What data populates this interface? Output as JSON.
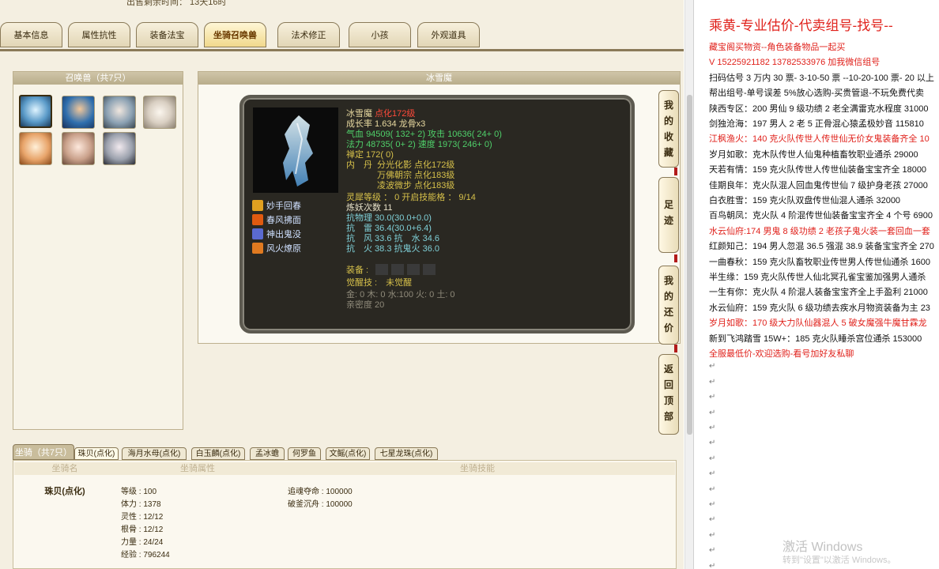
{
  "top_info": "出售剩余时间： 13天16时",
  "tabs": [
    "基本信息",
    "属性抗性",
    "装备法宝",
    "坐骑召唤兽",
    "法术修正",
    "小孩",
    "外观道具"
  ],
  "summon_panel_title": "召唤兽（共7只）",
  "detail_panel_title": "冰雪魔",
  "pet": {
    "name": "冰雪魔",
    "grade": "点化172级",
    "growth": "成长率 1.634 龙骨x3",
    "hp_label": "气血",
    "hp": "94509( 132+ 2)",
    "atk_label": "攻击",
    "atk": "10636( 24+ 0)",
    "mp_label": "法力",
    "mp": "48735( 0+ 2)",
    "spd_label": "速度",
    "spd": "1973( 246+ 0)",
    "zen": "禅定 172( 0)",
    "neidan_label": "内　丹",
    "neidan": [
      "分光化影 点化172级",
      "万佛朝宗 点化183级",
      "凌波微步 点化183级"
    ],
    "lingxi": "灵犀等级 ： 0 开启技能格 ： 9/14",
    "lianyao": "炼妖次数 11",
    "resist": [
      "抗物理 30.0(30.0+0.0)",
      "抗　雷 36.4(30.0+6.4)",
      "抗　风 33.6 抗　水 34.6",
      "抗　火 38.3 抗鬼火 36.0"
    ],
    "equip_label": "装备 :",
    "awaken": "觉醒技 :　未觉醒",
    "elements": "金: 0 木: 0 水:100 火: 0 土: 0",
    "intimacy": "亲密度 20",
    "skills": [
      "妙手回春",
      "春风拂面",
      "神出鬼没",
      "风火燎原"
    ]
  },
  "side_buttons": [
    [
      "我",
      "的",
      "收",
      "藏"
    ],
    [
      "足",
      "迹"
    ],
    [
      "我",
      "的",
      "还",
      "价"
    ],
    [
      "返",
      "回",
      "顶",
      "部"
    ]
  ],
  "mount_tabs": [
    "坐骑（共7只）",
    "珠贝(点化)",
    "海月水母(点化)",
    "白玉麟(点化)",
    "孟冰蟾",
    "何罗鱼",
    "文鳐(点化)",
    "七星龙珠(点化)"
  ],
  "mount_headers": [
    "坐骑名",
    "坐骑属性",
    "坐骑技能"
  ],
  "mount": {
    "name": "珠贝(点化)",
    "stats": [
      "等级 : 100",
      "体力 : 1378",
      "灵性 : 12/12",
      "根骨 : 12/12",
      "力量 : 24/24",
      "经验 : 796244"
    ],
    "skills": [
      "追魂夺命 : 100000",
      "破釜沉舟 : 100000"
    ]
  },
  "right": {
    "title": "乘黄-专业估价-代卖组号-找号--",
    "lines": [
      {
        "t": "藏宝阁买物资--角色装备物品一起买",
        "c": "red"
      },
      {
        "t": "V 15225921182  13782533976  加我微信组号",
        "c": "red"
      },
      {
        "t": "扫码估号 3 万内 30 票- 3-10-50 票  --10-20-100 票- 20 以上",
        "c": "blk"
      },
      {
        "t": "帮出组号-单号误差 5%放心选购-买贵管退-不玩免费代卖",
        "c": "blk"
      },
      {
        "t": "陕西专区：200 男仙 9 级功绩 2 老全满雷克水程度 31000",
        "c": "blk"
      },
      {
        "t": "剑独沧海：197 男人 2 老 5 正骨混心猿孟极妙音 115810",
        "c": "blk"
      },
      {
        "t": "江枫渔火：140 克火队传世人传世仙无价女鬼装备齐全 10",
        "c": "red"
      },
      {
        "t": "岁月如歌：克木队传世人仙鬼种植畜牧职业通杀 29000",
        "c": "blk"
      },
      {
        "t": "天若有情：159 克火队传世人传世仙装备宝宝齐全 18000",
        "c": "blk"
      },
      {
        "t": "佳期良年：克火队混人回血鬼传世仙 7 级护身老孩 27000",
        "c": "blk"
      },
      {
        "t": "白衣胜雪：159 克火队双盘传世仙混人通杀 32000",
        "c": "blk"
      },
      {
        "t": "百鸟朝凤：克火队 4 阶混传世仙装备宝宝齐全 4 个号 6900",
        "c": "blk"
      },
      {
        "t": "水云仙府:174 男鬼 8 级功绩 2 老孩子鬼火装一套回血一套",
        "c": "red"
      },
      {
        "t": "红颜知己：194 男人忽混 36.5 强混 38.9 装备宝宝齐全 270",
        "c": "blk"
      },
      {
        "t": "一曲春秋：159 克火队畜牧职业传世男人传世仙通杀 1600",
        "c": "blk"
      },
      {
        "t": "半生缘：159 克火队传世人仙北冥孔雀宝鉴加强男人通杀",
        "c": "blk"
      },
      {
        "t": "一生有你：克火队 4 阶混人装备宝宝齐全上手盈利 21000",
        "c": "blk"
      },
      {
        "t": "水云仙府：159 克火队 6 级功绩去疾水月物资装备为主 23",
        "c": "blk"
      },
      {
        "t": "岁月如歌：170 级大力队仙器混人 5 破女魔强牛魔甘霖龙",
        "c": "red"
      },
      {
        "t": "新到飞鸿踏雪 15W+：185 克火队睡杀宫位通杀 153000",
        "c": "blk"
      },
      {
        "t": "全服最低价-欢迎选购-看号加好友私聊",
        "c": "red"
      }
    ]
  },
  "watermark": "激活 Windows",
  "watermark_sub": "转到\"设置\"以激活 Windows。"
}
